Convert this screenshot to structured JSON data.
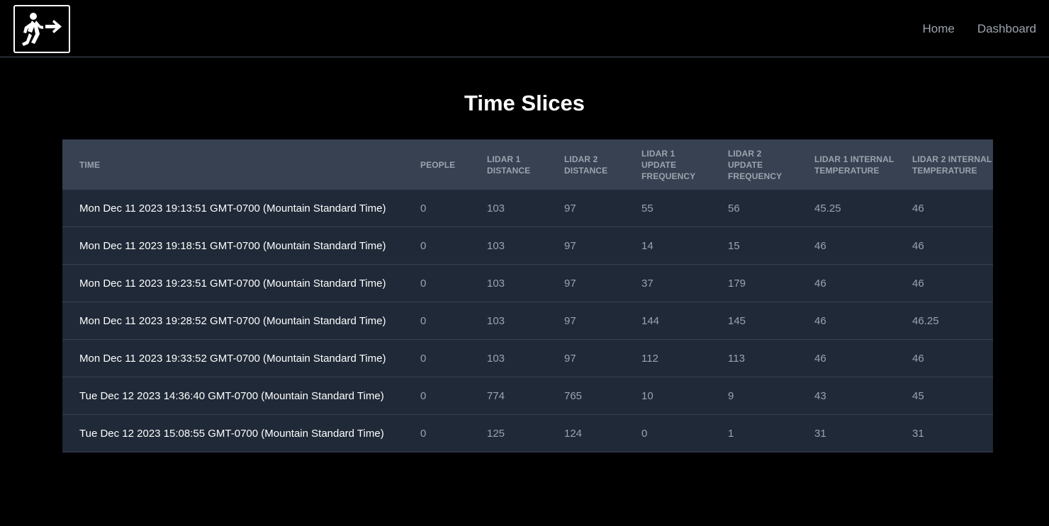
{
  "nav": {
    "logo_icon": "exit-walking-person-icon",
    "links": [
      {
        "label": "Home"
      },
      {
        "label": "Dashboard"
      }
    ]
  },
  "page": {
    "title": "Time Slices"
  },
  "table": {
    "headers": [
      "Time",
      "People",
      "Lidar 1 Distance",
      "Lidar 2 Distance",
      "Lidar 1 Update Frequency",
      "Lidar 2 Update Frequency",
      "Lidar 1 Internal Temperature",
      "Lidar 2 Internal Temperature"
    ],
    "rows": [
      [
        "Mon Dec 11 2023 19:13:51 GMT-0700 (Mountain Standard Time)",
        "0",
        "103",
        "97",
        "55",
        "56",
        "45.25",
        "46"
      ],
      [
        "Mon Dec 11 2023 19:18:51 GMT-0700 (Mountain Standard Time)",
        "0",
        "103",
        "97",
        "14",
        "15",
        "46",
        "46"
      ],
      [
        "Mon Dec 11 2023 19:23:51 GMT-0700 (Mountain Standard Time)",
        "0",
        "103",
        "97",
        "37",
        "179",
        "46",
        "46"
      ],
      [
        "Mon Dec 11 2023 19:28:52 GMT-0700 (Mountain Standard Time)",
        "0",
        "103",
        "97",
        "144",
        "145",
        "46",
        "46.25"
      ],
      [
        "Mon Dec 11 2023 19:33:52 GMT-0700 (Mountain Standard Time)",
        "0",
        "103",
        "97",
        "112",
        "113",
        "46",
        "46"
      ],
      [
        "Tue Dec 12 2023 14:36:40 GMT-0700 (Mountain Standard Time)",
        "0",
        "774",
        "765",
        "10",
        "9",
        "43",
        "45"
      ],
      [
        "Tue Dec 12 2023 15:08:55 GMT-0700 (Mountain Standard Time)",
        "0",
        "125",
        "124",
        "0",
        "1",
        "31",
        "31"
      ]
    ]
  },
  "colors": {
    "background": "#000000",
    "header_bg": "#374151",
    "row_bg": "#1f2937",
    "muted_text": "#9ca3af"
  }
}
